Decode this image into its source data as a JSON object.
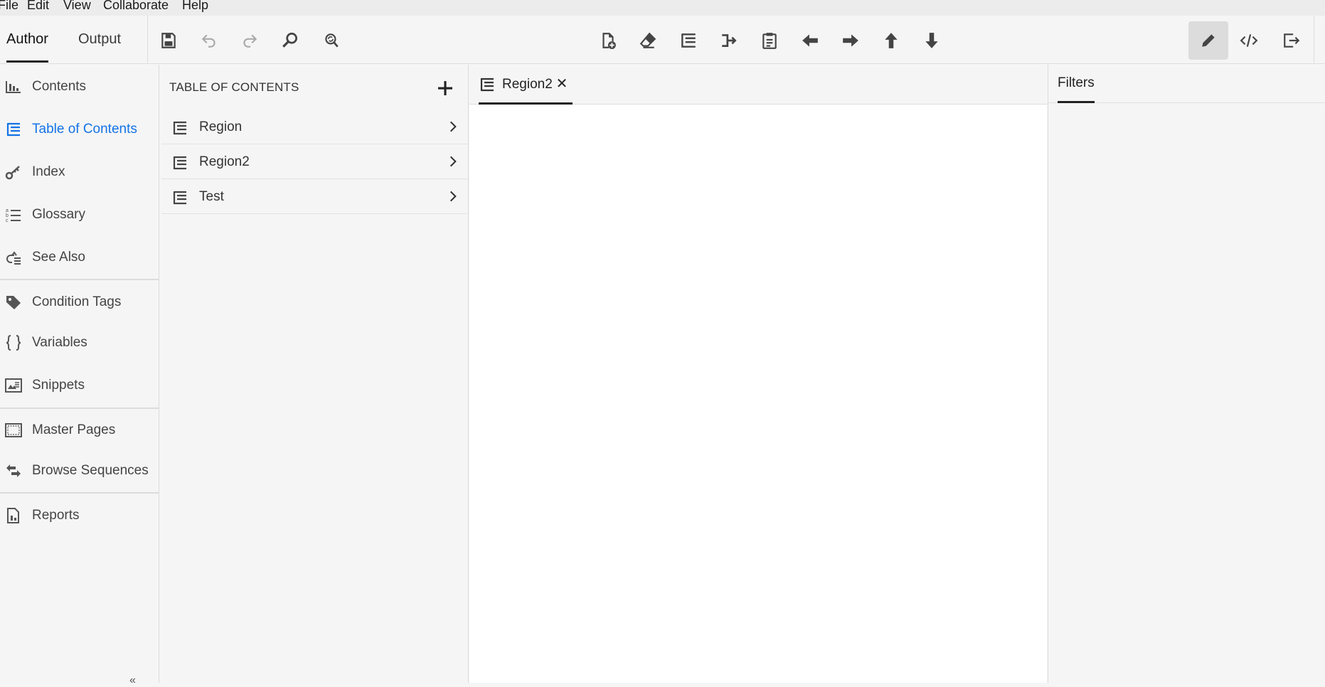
{
  "menu": [
    "File",
    "Edit",
    "View",
    "Collaborate",
    "Help"
  ],
  "modes": {
    "author": "Author",
    "output": "Output"
  },
  "toolbar": {
    "left_icons": [
      "save-icon",
      "undo-icon",
      "redo-icon",
      "find-icon",
      "find-replace-icon"
    ],
    "center_icons": [
      "new-document-icon",
      "eraser-icon",
      "toc-icon",
      "link-arrow-icon",
      "clipboard-icon",
      "arrow-left-icon",
      "arrow-right-icon",
      "arrow-up-icon",
      "arrow-down-icon"
    ],
    "right_icons": [
      "pencil-icon",
      "code-view-icon",
      "exit-icon"
    ]
  },
  "nav": {
    "items": [
      {
        "label": "Contents",
        "icon": "contents-icon"
      },
      {
        "label": "Table of Contents",
        "icon": "toc-icon",
        "active": true
      },
      {
        "label": "Index",
        "icon": "key-icon"
      },
      {
        "label": "Glossary",
        "icon": "glossary-icon"
      },
      {
        "label": "See Also",
        "icon": "see-also-icon"
      },
      {
        "label": "Condition Tags",
        "icon": "tag-icon"
      },
      {
        "label": "Variables",
        "icon": "braces-icon"
      },
      {
        "label": "Snippets",
        "icon": "snippet-icon"
      },
      {
        "label": "Master Pages",
        "icon": "master-page-icon"
      },
      {
        "label": "Browse Sequences",
        "icon": "browse-sequence-icon"
      },
      {
        "label": "Reports",
        "icon": "reports-icon"
      }
    ],
    "collapse_glyph": "«"
  },
  "toc": {
    "title": "TABLE OF CONTENTS",
    "items": [
      {
        "label": "Region"
      },
      {
        "label": "Region2"
      },
      {
        "label": "Test"
      }
    ]
  },
  "editor": {
    "tab_label": "Region2",
    "close_glyph": "✕"
  },
  "right_panel": {
    "tab_label": "Filters"
  },
  "colors": {
    "accent": "#1473e6",
    "panel_bg": "#f5f5f5",
    "icon": "#444444"
  }
}
